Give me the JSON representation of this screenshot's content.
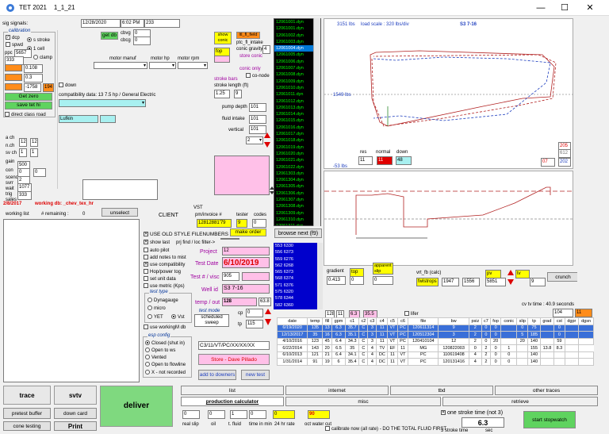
{
  "window": {
    "title": "TET 2021",
    "version": "1_1_21",
    "minimize": "—",
    "maximize": "☐",
    "close": "✕"
  },
  "header": {
    "sig_label": "sig signals:",
    "date": "12/28/2020",
    "time": "6:02 PM",
    "count": "233"
  },
  "calibration": {
    "title": "calibration",
    "dcp": "dcp",
    "spwd": "spwd",
    "s_stroke": "s stroke",
    "one_cell": "1 cell",
    "clamp": "clamp",
    "ppc_label": "ppc",
    "ppc_val": "5657",
    "idl_val": "333",
    "r1": "0.108",
    "r2": "0.3",
    "r3": "-1758",
    "r3b": "194",
    "get_zero": "Get zero",
    "save_tet_hi": "save tet hi",
    "direct_class_road": "direct class road"
  },
  "get_db": {
    "label": "get db",
    "cbvg_label": "cbvg",
    "cbvg": "0",
    "cbcg_label": "cbcg",
    "cbcg": "0"
  },
  "motor": {
    "motor_manuf": "motor manuf",
    "motor_hp": "motor hp",
    "motor_rpm": "motor rpm",
    "down": "down",
    "compat": "compatibility data: 13 7.5 hp / General Electric",
    "lufkin": "Lufkin"
  },
  "pump": {
    "show_conic": "show conic",
    "ltl_field": "ltl_fl_field",
    "ptc_intake": "ptc_fl_intake",
    "conic_gravity": "conic gravity",
    "conic_g_val": "4",
    "fop": "fop",
    "store_conic": "store conic",
    "conic_only": "conic only",
    "co_node": "co-node",
    "stroke_bars": "stroke bars",
    "stroke_length": "stroke length (ft)",
    "sl1": "1.25",
    "sl2": "9",
    "pump_depth": "pump depth",
    "pump_depth_val": "101",
    "fluid_intake": "fluid intake",
    "fluid_intake_val": "101",
    "vertical": "vertical",
    "vertical_val": "101",
    "spin": "2"
  },
  "side_small": {
    "n1": "12",
    "n2": "12",
    "n3": "1",
    "n4": "1",
    "gain_label": "gain",
    "gain": "500",
    "c2": "0",
    "c3": "0",
    "c4": "2",
    "c5": "1077",
    "c6": "333",
    "lbl_a": "a ch",
    "lbl_b": "n.ch",
    "lbl_c": "sv ch",
    "lbl_d": "con",
    "lbl_e": "sceno",
    "lbl_f": "svrr",
    "lbl_g": "wait",
    "lbl_h": "trig",
    "lbl_i": "sales"
  },
  "files": [
    "12061001.dyn",
    "12061001.dyn",
    "12061002.dyn",
    "12061003.dyn",
    "12061004.dyn",
    "12061005.dyn",
    "12061006.dyn",
    "12061007.dyn",
    "12061008.dyn",
    "12061009.dyn",
    "12061010.dyn",
    "12061011.dyn",
    "12061012.dyn",
    "12061013.dyn",
    "12061014.dyn",
    "12061015.dyn",
    "12061016.dyn",
    "12061017.dyn",
    "12061018.dyn",
    "12061019.dyn",
    "12061020.dyn",
    "12061021.dyn",
    "12061022.dyn",
    "12061303.dyn",
    "12061304.dyn",
    "12061305.dyn",
    "12061306.dyn",
    "12061307.dyn",
    "12061308.dyn",
    "12061309.dyn",
    "12061310.dyn",
    "12061311.dyn",
    "12061312.dyn"
  ],
  "selected_file_index": 4,
  "browse_next": "browse next (f9)",
  "blue_list": [
    "553 6330",
    "556 6373",
    "559 6276",
    "562 6268",
    "565 6373",
    "568 6374",
    "571 6376",
    "575 6320",
    "578 6344",
    "582 6360"
  ],
  "chart_top": {
    "max_load": "3151 lbs",
    "load_scale": "load scale : 320 lbs/div",
    "well": "S3 7-16",
    "mid": "1549 lbs",
    "min": "-53 lbs",
    "res": "res",
    "normal": "normal",
    "down": "down",
    "res_val": "11",
    "normal_val": "11",
    "down_val": "48",
    "r1": "205",
    "r2": "612",
    "r3": "07",
    "r4": "202"
  },
  "chart_top_color": {
    "red": "#b22222",
    "blue": "#1f3fbf",
    "green": "#2e8b2e"
  },
  "middle": {
    "date_line": "2/8/2017",
    "working_db": "working db: _chev_tex_hr",
    "working_list": "working list",
    "remaining": "# remaining :",
    "remaining_val": "0",
    "unselect": "unselect",
    "vst": "VST",
    "client": "CLIENT",
    "pm_invoice": "pm/invoice #",
    "tester": "tester",
    "codes": "codes",
    "invoice": "12812881'79",
    "tester_val": "9",
    "codes_val": "0",
    "use_old": "USE OLD STYLE FILENUMBERS",
    "show_last": "show last",
    "prj_find": "prj find / loc filter->",
    "make_order": "make order",
    "auto_pilot": "auto pilot",
    "add_notes": "add notes to mist",
    "use_compat": "use compatibility",
    "hopper": "Hop/power tog",
    "set_unit": "set unit data",
    "use_metric": "use metric (Kps)",
    "project": "Project",
    "project_val": "12",
    "test_date": "Test Date",
    "test_date_val": "6/10/2019",
    "test_visc": "Test # / visc",
    "test_visc_val": "905",
    "well_id": "Well id",
    "well_id_val": "S3 7-16",
    "temp_out": "temp / out",
    "temp_val": "128",
    "temp_b": "63.8",
    "cp": "cp",
    "cp_val": "0",
    "tp": "tp",
    "tp_val": "115",
    "test_type": "test type",
    "dynagauge": "Dynagauge",
    "micro": "micro",
    "yet": "YET",
    "vst2": "Vst",
    "test_mode": "test mode",
    "scheduled": "scheduled",
    "sweep": "sweep",
    "use_working": "use workingM db",
    "esp_config": "esp config",
    "closed": "Closed (shut in)",
    "open_to_ws": "Open to ws",
    "vented": "Vented",
    "open_flowline": "Open to flowline",
    "x_not_recorded": "X - not recorded",
    "config_val": "C3/11/VT/PC/XX/XX/XX",
    "store": "Store - Dave Pillado",
    "add_downers": "add to downers",
    "new_test": "new test"
  },
  "chart_bottom": {
    "gradient_label": "gradient",
    "gradient": "0.413",
    "top_label": "top",
    "top_val": "0",
    "apparent_slip": "apparent slip",
    "slip_val": "0",
    "vrt_fb": "vrt_fb (calc)",
    "fb_label": "fwlstrops",
    "fb1": "1947",
    "fb2": "1556",
    "pv": "pv",
    "pv_val": "5851",
    "tv": "tv",
    "tv_val": "9",
    "crunch": "crunch",
    "cv_time": "cv tv time : 40.9 seconds",
    "box1": "104",
    "box2": "11"
  },
  "table": {
    "controls": {
      "n1": "128",
      "n2": "11",
      "n3": "6.3",
      "n4": "35.5",
      "lifer": "lifer"
    },
    "headers": [
      "date",
      "temp",
      "fill",
      "gpm",
      "c1",
      "c2",
      "c3",
      "c4",
      "c5",
      "c6",
      "file",
      "bw",
      "psiz",
      "c7",
      "fop",
      "conic",
      "slip",
      "tp",
      "grad",
      "cst",
      "dgpr",
      "dgsn"
    ],
    "rows": [
      [
        "6/19/2020",
        "135",
        "13",
        "6.3",
        "35.7",
        "C",
        "3",
        "11",
        "VT",
        "PC",
        "120611314",
        "9",
        "2",
        "0",
        "0",
        "",
        "0",
        "75",
        "",
        "0",
        "",
        ""
      ],
      [
        "12/13/2017",
        "35",
        "16",
        "6.3",
        "35.1",
        "C",
        "3",
        "11",
        "VT",
        "PC",
        "120512304",
        "3",
        "2",
        "0",
        "0",
        "",
        "5",
        "185",
        "",
        "0",
        "",
        ""
      ],
      [
        "4/10/2016",
        "123",
        "45",
        "6.4",
        "34.3",
        "C",
        "3",
        "11",
        "VT",
        "PC",
        "120410104",
        "12",
        "2",
        "0",
        "20",
        "",
        "20",
        "140",
        "",
        "59",
        "",
        ""
      ],
      [
        "6/22/2014",
        "143",
        "20",
        "6.5",
        "35",
        "C",
        "4",
        "TV",
        "EF",
        "11",
        "MG",
        "120822003",
        "0",
        "2",
        "0",
        "1",
        "",
        "155",
        "13.8",
        "8.3",
        ""
      ],
      [
        "6/10/2013",
        "121",
        "21",
        "6.4",
        "34.1",
        "C",
        "4",
        "DC",
        "11",
        "VT",
        "PC",
        "110619408",
        "4",
        "2",
        "0",
        "0",
        "",
        "140",
        "",
        "",
        "",
        ""
      ],
      [
        "1/31/2014",
        "91",
        "19",
        "6",
        "35.4",
        "C",
        "4",
        "DC",
        "11",
        "VT",
        "PC",
        "120131416",
        "4",
        "2",
        "0",
        "0",
        "",
        "140",
        "",
        "",
        "",
        ""
      ]
    ]
  },
  "bottom": {
    "trace": "trace",
    "svtv": "svtv",
    "deliver": "deliver",
    "pretest_buffer": "pretest buffer",
    "down_card": "down card",
    "cone_testing": "cone testing",
    "print": "Print",
    "tabs": [
      "list",
      "internet",
      "tbd",
      "other traces"
    ],
    "tabs2": [
      "misc",
      "retrieve"
    ],
    "production_calc": "production calculator",
    "pc_vals": [
      "0",
      "0",
      "1",
      "0",
      "0",
      "90"
    ],
    "pc_labels": [
      "real slip",
      "oil",
      "t. fluid",
      "time in min",
      "24 hr rate",
      "oct water cut"
    ],
    "calibrate": "calibrate now (all rate) - DO THE TOTAL FLUID FIRST",
    "one_stroke": "one stroke time (not 3)",
    "stroke_time": "6.3",
    "stroke_time_label": "3 stroke time",
    "sec": "sec",
    "stopwatch": "start stopwatch"
  }
}
